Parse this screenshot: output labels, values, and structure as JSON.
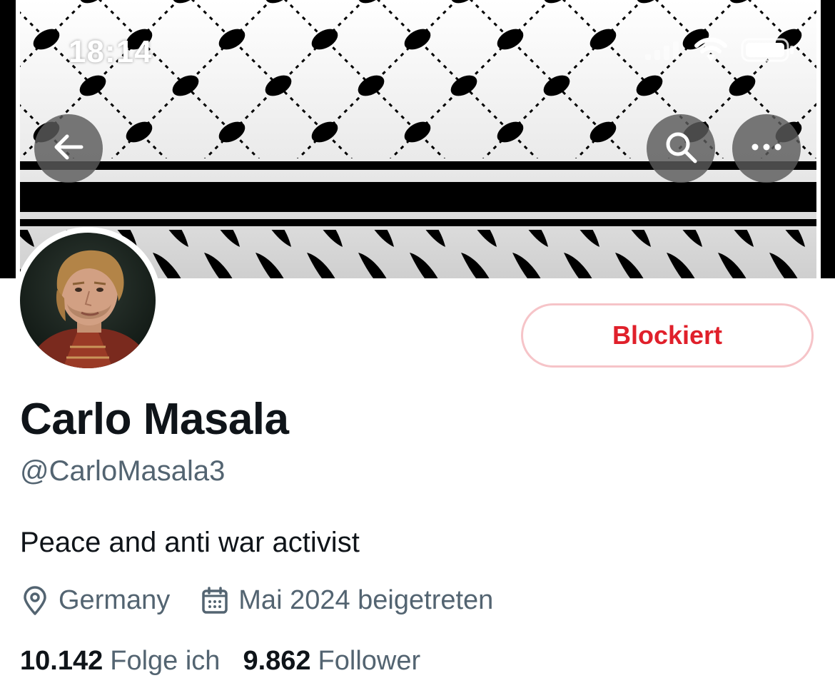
{
  "status_bar": {
    "time": "18:14",
    "icons": [
      "signal-icon",
      "wifi-icon",
      "battery-icon"
    ]
  },
  "banner": {
    "pattern": "keffiyeh",
    "colors": {
      "ink": "#000000",
      "background": "#e6e6e6"
    }
  },
  "nav": {
    "back_icon": "arrow-left-icon",
    "search_icon": "search-icon",
    "more_icon": "more-horizontal-icon"
  },
  "profile": {
    "display_name": "Carlo Masala",
    "handle": "@CarloMasala3",
    "bio": "Peace and anti war activist",
    "location": "Germany",
    "joined": "Mai 2024 beigetreten",
    "following_count": "10.142",
    "following_label": "Folge ich",
    "followers_count": "9.862",
    "followers_label": "Follower"
  },
  "actions": {
    "blocked_label": "Blockiert"
  },
  "colors": {
    "text_primary": "#0f1419",
    "text_secondary": "#536471",
    "blocked_red": "#e0202b",
    "blocked_border": "#f6c4c8"
  }
}
